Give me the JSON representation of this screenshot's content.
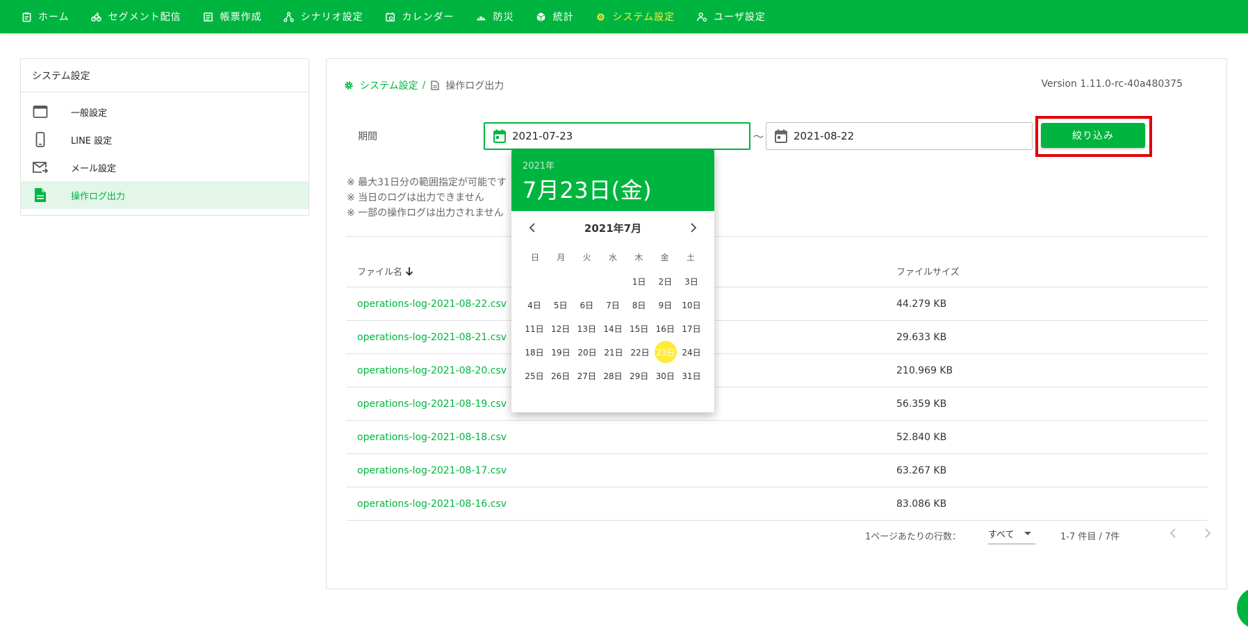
{
  "nav": {
    "items": [
      {
        "label": "ホーム",
        "icon": "clipboard-icon"
      },
      {
        "label": "セグメント配信",
        "icon": "bicycle-icon"
      },
      {
        "label": "帳票作成",
        "icon": "form-icon"
      },
      {
        "label": "シナリオ設定",
        "icon": "tree-icon"
      },
      {
        "label": "カレンダー",
        "icon": "calendar-clock-icon"
      },
      {
        "label": "防災",
        "icon": "disaster-icon"
      },
      {
        "label": "統計",
        "icon": "cube-icon"
      },
      {
        "label": "システム設定",
        "icon": "gear-icon",
        "active": true
      },
      {
        "label": "ユーザ設定",
        "icon": "user-gear-icon"
      }
    ]
  },
  "sidebar": {
    "title": "システム設定",
    "items": [
      {
        "label": "一般設定",
        "icon": "window-icon"
      },
      {
        "label": "LINE 設定",
        "icon": "phone-icon"
      },
      {
        "label": "メール設定",
        "icon": "mail-icon"
      },
      {
        "label": "操作ログ出力",
        "icon": "document-icon",
        "active": true
      }
    ]
  },
  "breadcrumb": {
    "parent": "システム設定",
    "separator": "/",
    "current": "操作ログ出力"
  },
  "version": "Version 1.11.0-rc-40a480375",
  "filter": {
    "period_label": "期間",
    "start_date": "2021-07-23",
    "end_date": "2021-08-22",
    "tilde": "～",
    "button_label": "絞り込み"
  },
  "notes": [
    "※ 最大31日分の範囲指定が可能です",
    "※ 当日のログは出力できません",
    "※ 一部の操作ログは出力されません"
  ],
  "table": {
    "columns": {
      "name": "ファイル名",
      "size": "ファイルサイズ"
    },
    "rows": [
      {
        "name": "operations-log-2021-08-22.csv",
        "size": "44.279 KB"
      },
      {
        "name": "operations-log-2021-08-21.csv",
        "size": "29.633 KB"
      },
      {
        "name": "operations-log-2021-08-20.csv",
        "size": "210.969 KB"
      },
      {
        "name": "operations-log-2021-08-19.csv",
        "size": "56.359 KB"
      },
      {
        "name": "operations-log-2021-08-18.csv",
        "size": "52.840 KB"
      },
      {
        "name": "operations-log-2021-08-17.csv",
        "size": "63.267 KB"
      },
      {
        "name": "operations-log-2021-08-16.csv",
        "size": "83.086 KB"
      }
    ]
  },
  "pagination": {
    "rows_per_page_label": "1ページあたりの行数：",
    "rows_per_page_value": "すべて",
    "range_text": "1-7 件目 / 7件"
  },
  "datepicker": {
    "year": "2021年",
    "selected_label": "7月23日(金)",
    "month_label": "2021年7月",
    "weekdays": [
      "日",
      "月",
      "火",
      "水",
      "木",
      "金",
      "土"
    ],
    "weeks": [
      [
        "",
        "",
        "",
        "",
        "1日",
        "2日",
        "3日"
      ],
      [
        "4日",
        "5日",
        "6日",
        "7日",
        "8日",
        "9日",
        "10日"
      ],
      [
        "11日",
        "12日",
        "13日",
        "14日",
        "15日",
        "16日",
        "17日"
      ],
      [
        "18日",
        "19日",
        "20日",
        "21日",
        "22日",
        "23日",
        "24日"
      ],
      [
        "25日",
        "26日",
        "27日",
        "28日",
        "29日",
        "30日",
        "31日"
      ]
    ],
    "selected_day": "23日",
    "colors": {
      "header": "#00b53f",
      "selected": "#ffeb3b"
    }
  },
  "colors": {
    "brand": "#00b53f",
    "active_nav": "#ffeb3b",
    "highlight_border": "#e00000"
  }
}
